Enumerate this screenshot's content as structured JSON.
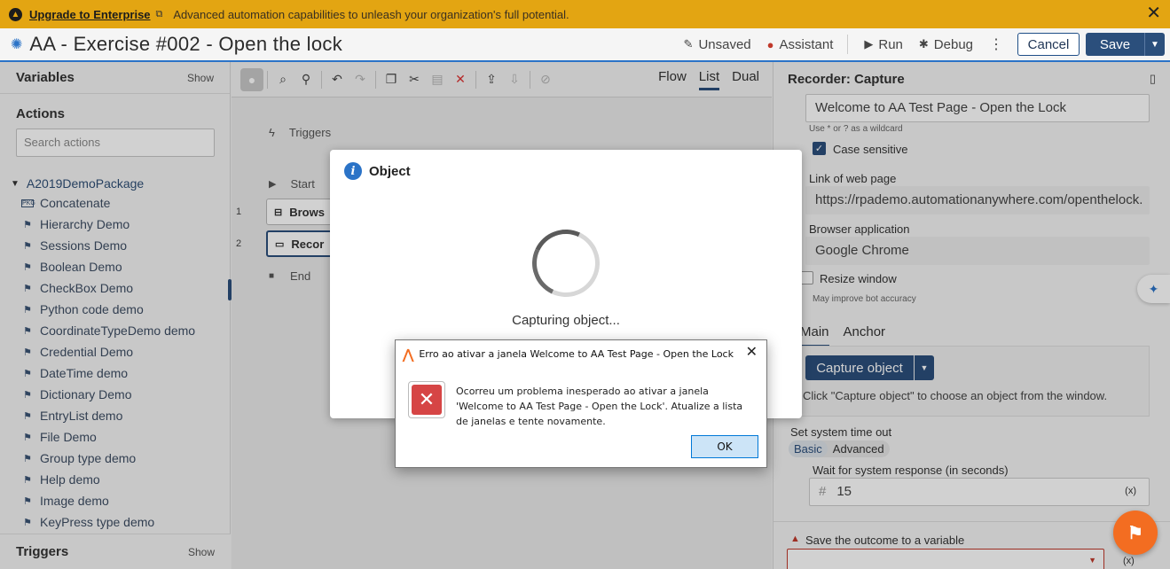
{
  "banner": {
    "link": "Upgrade to Enterprise",
    "message": "Advanced automation capabilities to unleash your organization's full potential."
  },
  "titlebar": {
    "title": "AA - Exercise #002 - Open the lock",
    "unsaved": "Unsaved",
    "assistant": "Assistant",
    "run": "Run",
    "debug": "Debug",
    "cancel": "Cancel",
    "save": "Save"
  },
  "left": {
    "variables": "Variables",
    "show": "Show",
    "actions": "Actions",
    "search_placeholder": "Search actions",
    "package": "A2019DemoPackage",
    "items": [
      {
        "label": "Concatenate",
        "icon": "pkg-icon"
      },
      {
        "label": "Hierarchy Demo",
        "icon": "hierarchy-icon"
      },
      {
        "label": "Sessions Demo",
        "icon": "flag-icon"
      },
      {
        "label": "Boolean Demo",
        "icon": "flag-icon"
      },
      {
        "label": "CheckBox Demo",
        "icon": "flag-icon"
      },
      {
        "label": "Python code demo",
        "icon": "flag-icon"
      },
      {
        "label": "CoordinateTypeDemo demo",
        "icon": "flag-icon"
      },
      {
        "label": "Credential Demo",
        "icon": "flag-icon"
      },
      {
        "label": "DateTime demo",
        "icon": "flag-icon"
      },
      {
        "label": "Dictionary Demo",
        "icon": "flag-icon"
      },
      {
        "label": "EntryList demo",
        "icon": "flag-icon"
      },
      {
        "label": "File Demo",
        "icon": "flag-icon"
      },
      {
        "label": "Group type demo",
        "icon": "hierarchy-icon"
      },
      {
        "label": "Help demo",
        "icon": "flag-icon"
      },
      {
        "label": "Image demo",
        "icon": "flag-icon"
      },
      {
        "label": "KeyPress type demo",
        "icon": "flag-icon"
      }
    ],
    "triggers": "Triggers"
  },
  "center": {
    "views": [
      "Flow",
      "List",
      "Dual"
    ],
    "active_view": "List",
    "triggers": "Triggers",
    "start": "Start",
    "end": "End",
    "steps": [
      {
        "num": "1",
        "label": "Brows"
      },
      {
        "num": "2",
        "label": "Recor"
      }
    ]
  },
  "right": {
    "title": "Recorder: Capture",
    "window_title_value": "Welcome to AA Test Page - Open the Lock",
    "wildcard_hint": "Use * or ? as a wildcard",
    "case_sensitive": "Case sensitive",
    "link_label": "Link of web page",
    "link_value": "https://rpademo.automationanywhere.com/openthelock.",
    "browser_label": "Browser application",
    "browser_value": "Google Chrome",
    "resize_label": "Resize window",
    "resize_hint": "May improve bot accuracy",
    "tab_main": "Main",
    "tab_anchor": "Anchor",
    "capture_button": "Capture object",
    "capture_hint": "Click \"Capture object\" to choose an object from the window.",
    "timeout_label": "Set system time out",
    "basic": "Basic",
    "advanced": "Advanced",
    "wait_label": "Wait for system response (in seconds)",
    "wait_value": "15",
    "var_symbol": "(x)",
    "outcome_label": "Save the outcome to a variable"
  },
  "modal": {
    "title": "Object",
    "status": "Capturing object..."
  },
  "dialog": {
    "title": "Erro ao ativar a janela Welcome to AA Test Page - Open the Lock",
    "message": "Ocorreu um problema inesperado ao ativar a janela 'Welcome to AA Test Page - Open the Lock'. Atualize a lista de janelas e tente novamente.",
    "ok": "OK"
  },
  "colors": {
    "banner": "#e3a512",
    "primary": "#2b4f7c",
    "accent": "#2b73c7",
    "fab": "#f36d21",
    "error": "#d64545"
  }
}
